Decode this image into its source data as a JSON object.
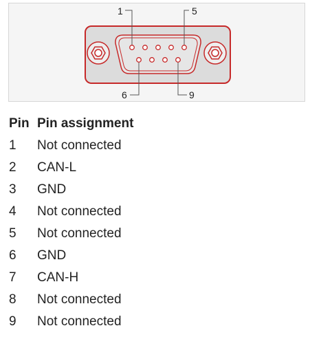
{
  "diagram": {
    "labels": {
      "pin1": "1",
      "pin5": "5",
      "pin6": "6",
      "pin9": "9"
    },
    "colors": {
      "outline": "#c62828",
      "fill": "#dcdcdc",
      "inner": "#e6e6e6",
      "line": "#555555"
    }
  },
  "table": {
    "headers": [
      "Pin",
      "Pin assignment"
    ],
    "rows": [
      {
        "pin": "1",
        "assignment": "Not connected"
      },
      {
        "pin": "2",
        "assignment": "CAN-L"
      },
      {
        "pin": "3",
        "assignment": "GND"
      },
      {
        "pin": "4",
        "assignment": "Not connected"
      },
      {
        "pin": "5",
        "assignment": "Not connected"
      },
      {
        "pin": "6",
        "assignment": "GND"
      },
      {
        "pin": "7",
        "assignment": "CAN-H"
      },
      {
        "pin": "8",
        "assignment": "Not connected"
      },
      {
        "pin": "9",
        "assignment": "Not connected"
      }
    ]
  }
}
